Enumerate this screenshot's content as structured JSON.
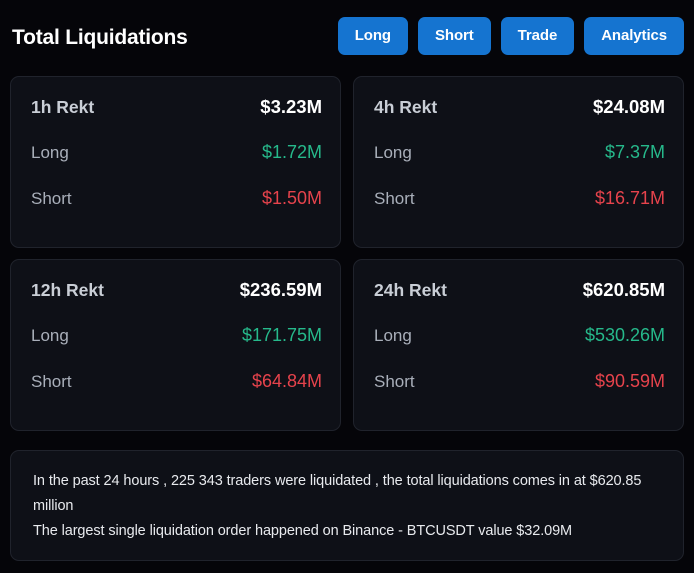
{
  "header": {
    "title": "Total Liquidations",
    "nav_buttons": [
      {
        "label": "Long"
      },
      {
        "label": "Short"
      },
      {
        "label": "Trade"
      },
      {
        "label": "Analytics"
      }
    ],
    "button_color": "#1574d0"
  },
  "colors": {
    "page_background": "#050509",
    "card_background": "#0e1017",
    "card_border": "#20232c",
    "long_green": "#26b98b",
    "short_red": "#e6434c",
    "value_white": "#ffffff",
    "label_grey": "#a9afba"
  },
  "cards": [
    {
      "title": "1h Rekt",
      "total": "$3.23M",
      "long_label": "Long",
      "long_value": "$1.72M",
      "short_label": "Short",
      "short_value": "$1.50M"
    },
    {
      "title": "4h Rekt",
      "total": "$24.08M",
      "long_label": "Long",
      "long_value": "$7.37M",
      "short_label": "Short",
      "short_value": "$16.71M"
    },
    {
      "title": "12h Rekt",
      "total": "$236.59M",
      "long_label": "Long",
      "long_value": "$171.75M",
      "short_label": "Short",
      "short_value": "$64.84M"
    },
    {
      "title": "24h Rekt",
      "total": "$620.85M",
      "long_label": "Long",
      "long_value": "$530.26M",
      "short_label": "Short",
      "short_value": "$90.59M"
    }
  ],
  "summary": {
    "line1": "In the past 24 hours , 225 343 traders were liquidated , the total liquidations comes in at $620.85 million",
    "line2": "The largest single liquidation order happened on Binance - BTCUSDT value $32.09M"
  }
}
